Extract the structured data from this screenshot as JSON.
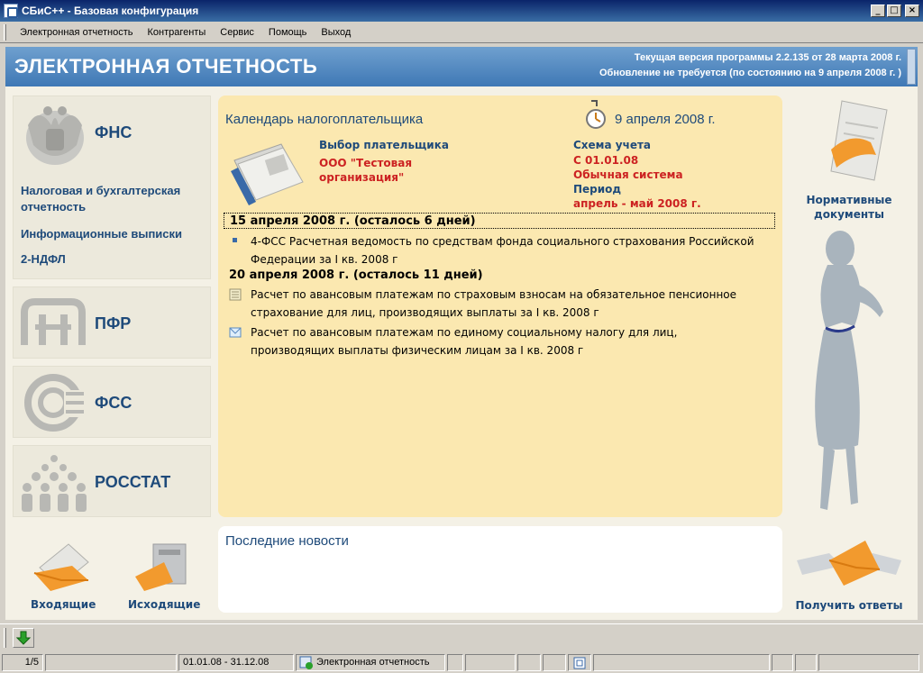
{
  "window": {
    "title": "СБиС++ - Базовая конфигурация"
  },
  "menu": [
    "Электронная отчетность",
    "Контрагенты",
    "Сервис",
    "Помощь",
    "Выход"
  ],
  "header": {
    "title": "ЭЛЕКТРОННАЯ ОТЧЕТНОСТЬ",
    "version_line": "Текущая версия программы 2.2.135 от 28 марта 2008 г.",
    "update_line": "Обновление не требуется (по состоянию на 9 апреля 2008 г. )"
  },
  "left": {
    "fns": {
      "name": "ФНС",
      "links": [
        "Налоговая и бухгалтерская отчетность",
        "Информационные выписки",
        "2-НДФЛ"
      ]
    },
    "pfr": {
      "name": "ПФР"
    },
    "fss": {
      "name": "ФСС"
    },
    "rosstat": {
      "name": "РОССТАТ"
    },
    "incoming": "Входящие",
    "outgoing": "Исходящие"
  },
  "calendar": {
    "title": "Календарь налогоплательщика",
    "date": "9 апреля 2008 г.",
    "payer_label": "Выбор плательщика",
    "payer_value": "ООО \"Тестовая организация\"",
    "scheme_label": "Схема учета",
    "scheme_from": "С 01.01.08",
    "scheme_value": "Обычная система",
    "period_label": "Период",
    "period_value": "апрель - май 2008 г.",
    "groups": [
      {
        "due": "15 апреля 2008 г. (осталось 6 дней)",
        "items": [
          "4-ФСС Расчетная ведомость по средствам фонда социального страхования Российской Федерации за I кв. 2008 г"
        ]
      },
      {
        "due": "20 апреля 2008 г. (осталось 11 дней)",
        "items": [
          "Расчет по авансовым платежам по страховым взносам на обязательное пенсионное страхование для лиц, производящих выплаты за I кв. 2008 г",
          "Расчет по авансовым платежам по единому социальному налогу для лиц, производящих выплаты физическим лицам за I кв. 2008 г"
        ]
      }
    ]
  },
  "news": {
    "title": "Последние новости"
  },
  "right": {
    "normative": "Нормативные документы",
    "get_answers": "Получить ответы"
  },
  "status": {
    "page": "1/5",
    "period": "01.01.08 - 31.12.08",
    "section": "Электронная отчетность"
  },
  "colors": {
    "accent": "#1e4a7a",
    "header_bg": "#4f86c0",
    "calendar_bg": "#fbe8b0",
    "red_value": "#cc2222"
  }
}
